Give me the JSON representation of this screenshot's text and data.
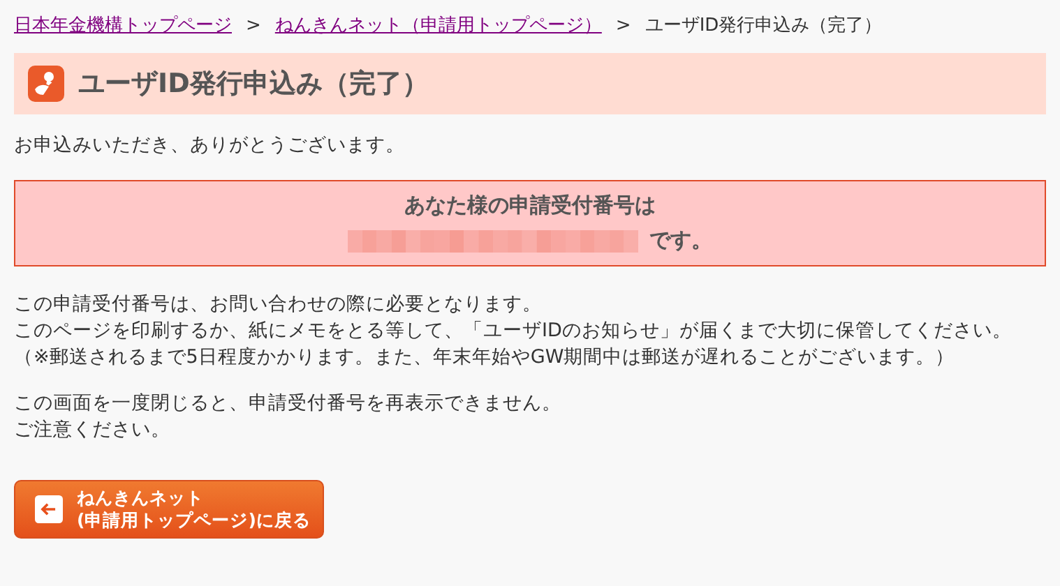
{
  "breadcrumb": [
    {
      "label": "日本年金機構トップページ",
      "kind": "link"
    },
    {
      "label": "ねんきんネット（申請用トップページ）",
      "kind": "link"
    },
    {
      "label": "ユーザID発行申込み（完了）",
      "kind": "current"
    }
  ],
  "separator": ">",
  "heading": "ユーザID発行申込み（完了）",
  "thanks": "お申込みいただき、ありがとうございます。",
  "notice_box": {
    "line_1": "あなた様の申請受付番号は",
    "suffix": "です。"
  },
  "paragraphs": [
    [
      "この申請受付番号は、お問い合わせの際に必要となります。",
      "このページを印刷するか、紙にメモをとる等して、「ユーザIDのお知らせ」が届くまで大切に保管してください。（※郵送されるまで5日程度かかります。また、年末年始やGW期間中は郵送が遅れることがございます。）"
    ],
    [
      "この画面を一度閉じると、申請受付番号を再表示できません。",
      "ご注意ください。"
    ]
  ],
  "back_button": {
    "line_1": "ねんきんネット",
    "line_2": "(申請用トップページ)に戻る"
  }
}
